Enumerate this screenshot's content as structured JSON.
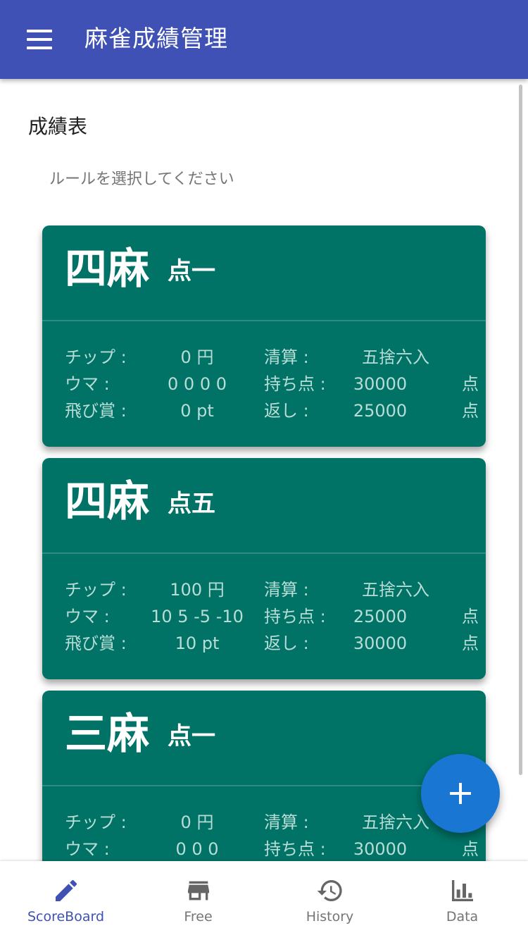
{
  "app_title": "麻雀成績管理",
  "section_title": "成績表",
  "hint": "ルールを選択してください",
  "colors": {
    "app_bar": "#3f51b5",
    "card": "#007366",
    "fab": "#1976d2",
    "nav_active": "#3f51b5"
  },
  "labels": {
    "chip": "チップ :",
    "uma": "ウマ :",
    "tobi": "飛び賞 :",
    "settlement": "清算 :",
    "start_points": "持ち点 :",
    "return_points": "返し :"
  },
  "rules": [
    {
      "players": "四麻",
      "rate": "点一",
      "chip": "0  円",
      "uma": "0 0 0 0",
      "tobi": "0  pt",
      "settlement": "五捨六入",
      "start_points": "30000",
      "start_unit": "点",
      "return_points": "25000",
      "return_unit": "点"
    },
    {
      "players": "四麻",
      "rate": "点五",
      "chip": "100  円",
      "uma": "10 5 -5 -10",
      "tobi": "10  pt",
      "settlement": "五捨六入",
      "start_points": "25000",
      "start_unit": "点",
      "return_points": "30000",
      "return_unit": "点"
    },
    {
      "players": "三麻",
      "rate": "点一",
      "chip": "0  円",
      "uma": "0 0 0",
      "settlement": "五捨六入",
      "start_points": "30000",
      "start_unit": "点"
    }
  ],
  "fab_icon": "plus-icon",
  "bottom_nav": [
    {
      "label": "ScoreBoard",
      "icon": "pencil-icon",
      "active": true
    },
    {
      "label": "Free",
      "icon": "store-icon",
      "active": false
    },
    {
      "label": "History",
      "icon": "history-icon",
      "active": false
    },
    {
      "label": "Data",
      "icon": "bar-chart-icon",
      "active": false
    }
  ]
}
